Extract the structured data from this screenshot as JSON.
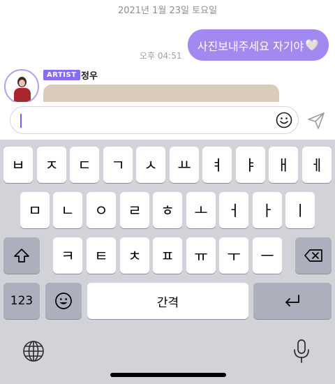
{
  "chat": {
    "date": "2021년 1월 23일 토요일",
    "outgoing_message": "사진보내주세요 자기야",
    "outgoing_heart": "🤍",
    "outgoing_time": "오후 04:51",
    "sender_badge": "ARTIST",
    "sender_name": "정우"
  },
  "input": {
    "value": ""
  },
  "keyboard": {
    "row1": [
      "ㅂ",
      "ㅈ",
      "ㄷ",
      "ㄱ",
      "ㅅ",
      "ㅛ",
      "ㅕ",
      "ㅑ",
      "ㅐ",
      "ㅔ"
    ],
    "row2": [
      "ㅁ",
      "ㄴ",
      "ㅇ",
      "ㄹ",
      "ㅎ",
      "ㅗ",
      "ㅓ",
      "ㅏ",
      "ㅣ"
    ],
    "row3": [
      "ㅋ",
      "ㅌ",
      "ㅊ",
      "ㅍ",
      "ㅠ",
      "ㅜ",
      "ㅡ"
    ],
    "numbers_label": "123",
    "space_label": "간격"
  },
  "colors": {
    "accent": "#8a6bf0",
    "bubble": "#a289f0",
    "keyboard_bg": "#d1d3d9"
  },
  "icons": [
    "emoji-icon",
    "send-icon",
    "shift-icon",
    "backspace-icon",
    "globe-icon",
    "microphone-icon",
    "return-icon"
  ]
}
